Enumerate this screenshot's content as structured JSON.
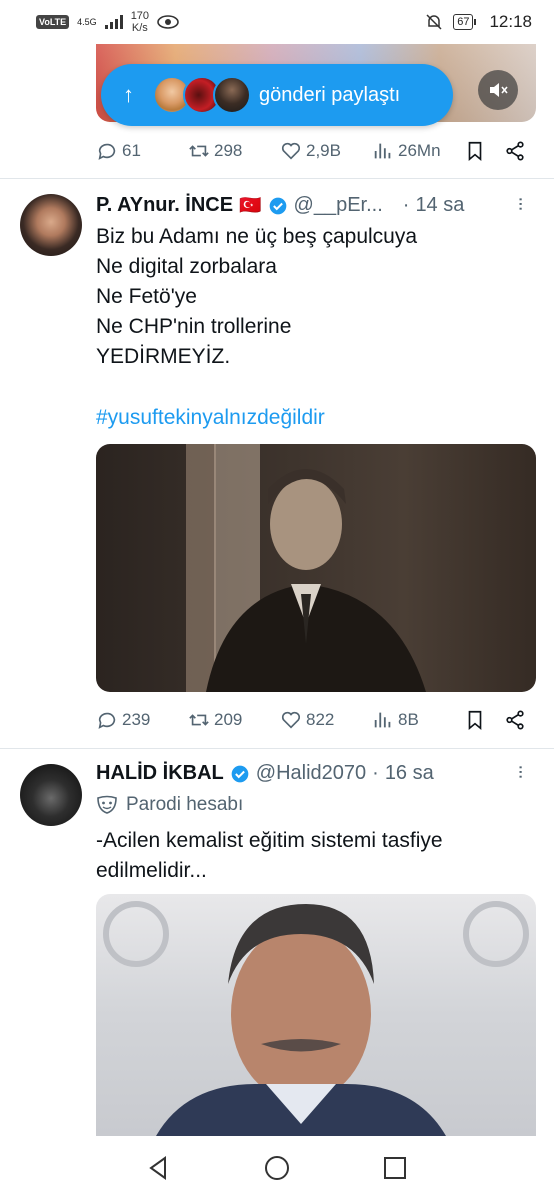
{
  "status_bar": {
    "network_type": "4.5G",
    "volte": "VoLTE",
    "speed_value": "170",
    "speed_unit": "K/s",
    "battery": "67",
    "time": "12:18"
  },
  "new_posts_pill": {
    "arrow": "↑",
    "label": "gönderi paylaştı"
  },
  "top_tweet_actions": {
    "replies": "61",
    "retweets": "298",
    "likes": "2,9B",
    "views": "26Mn"
  },
  "tweets": [
    {
      "name": "P. AYnur. İNCE",
      "flag": "🇹🇷",
      "handle": "@__pEr...",
      "time": "14 sa",
      "text_lines": [
        "Biz bu Adamı ne üç beş çapulcuya",
        "Ne digital zorbalara",
        "Ne Fetö'ye",
        "Ne CHP'nin trollerine",
        "YEDİRMEYİZ."
      ],
      "hashtag": "#yusuftekinyalnızdeğildir",
      "replies": "239",
      "retweets": "209",
      "likes": "822",
      "views": "8B"
    },
    {
      "name": "HALİD İKBAL",
      "handle": "@Halid2070",
      "time": "16 sa",
      "parody_label": "Parodi hesabı",
      "text_lines": [
        "-Acilen kemalist eğitim sistemi tasfiye",
        "edilmelidir..."
      ]
    }
  ],
  "colors": {
    "accent": "#1d9bf0",
    "muted": "#536471",
    "text": "#0f1419"
  },
  "icons": [
    "reply-icon",
    "retweet-icon",
    "like-icon",
    "views-icon",
    "bookmark-icon",
    "share-icon",
    "verified-icon",
    "more-icon",
    "mute-icon",
    "back-icon",
    "home-icon",
    "recents-icon",
    "mask-icon"
  ]
}
